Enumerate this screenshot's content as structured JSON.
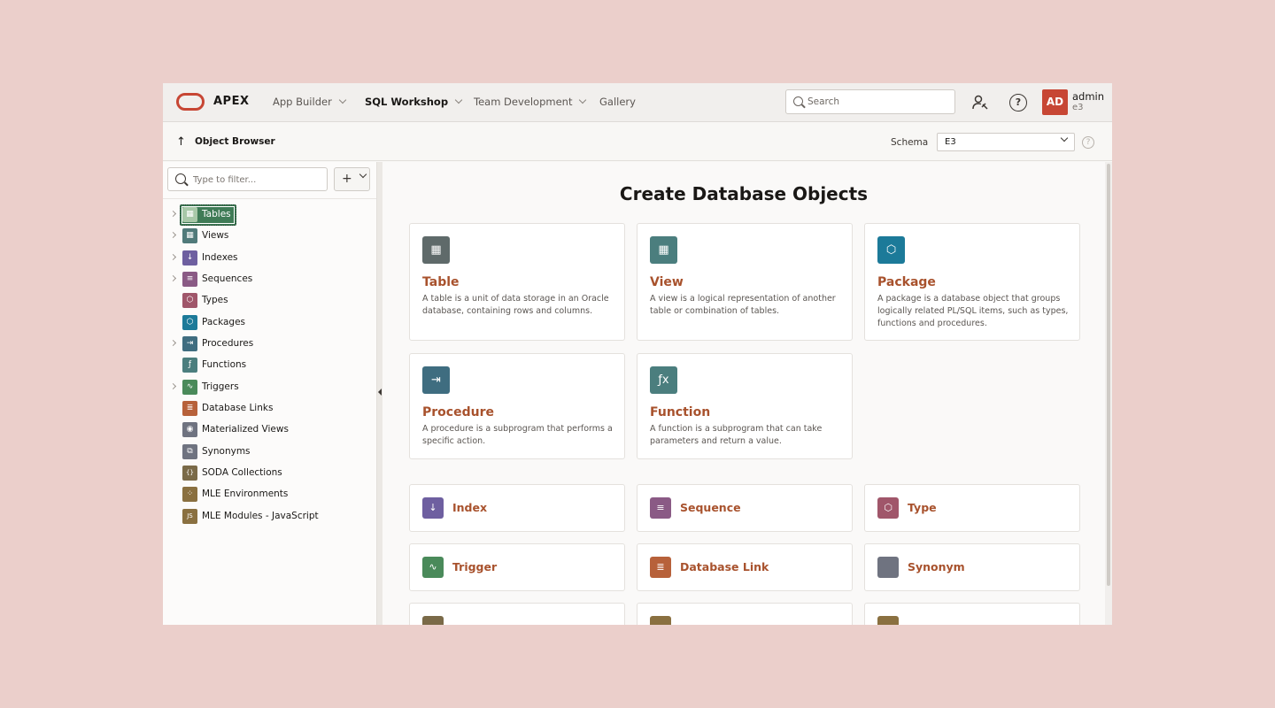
{
  "header": {
    "logo_text": "APEX",
    "nav": [
      {
        "label": "App Builder"
      },
      {
        "label": "SQL Workshop"
      },
      {
        "label": "Team Development"
      },
      {
        "label": "Gallery"
      }
    ],
    "search_placeholder": "Search",
    "help_glyph": "?",
    "user": {
      "initials": "AD",
      "name": "admin",
      "workspace": "e3"
    }
  },
  "titlebar": {
    "up_glyph": "↑",
    "title": "Object Browser",
    "schema_label": "Schema",
    "schema_value": "E3",
    "help_glyph": "?"
  },
  "sidebar": {
    "filter_placeholder": "Type to filter...",
    "add_glyph": "+",
    "items": [
      {
        "label": "Tables",
        "icon": "table-icon",
        "glyph": "▦",
        "expandable": true,
        "selected": true
      },
      {
        "label": "Views",
        "icon": "view-icon",
        "glyph": "▦",
        "expandable": true
      },
      {
        "label": "Indexes",
        "icon": "index-icon",
        "glyph": "↓",
        "expandable": true
      },
      {
        "label": "Sequences",
        "icon": "sequence-icon",
        "glyph": "≡",
        "expandable": true
      },
      {
        "label": "Types",
        "icon": "type-icon",
        "glyph": "⬡",
        "expandable": false
      },
      {
        "label": "Packages",
        "icon": "package-icon",
        "glyph": "⬡",
        "expandable": false
      },
      {
        "label": "Procedures",
        "icon": "procedure-icon",
        "glyph": "⇥",
        "expandable": true
      },
      {
        "label": "Functions",
        "icon": "function-icon",
        "glyph": "ƒ",
        "expandable": false
      },
      {
        "label": "Triggers",
        "icon": "trigger-icon",
        "glyph": "∿",
        "expandable": true
      },
      {
        "label": "Database Links",
        "icon": "database-link-icon",
        "glyph": "≣",
        "expandable": false
      },
      {
        "label": "Materialized Views",
        "icon": "materialized-view-icon",
        "glyph": "◉",
        "expandable": false
      },
      {
        "label": "Synonyms",
        "icon": "synonym-icon",
        "glyph": "⧉",
        "expandable": false
      },
      {
        "label": "SODA Collections",
        "icon": "soda-collection-icon",
        "glyph": "{}",
        "expandable": false
      },
      {
        "label": "MLE Environments",
        "icon": "mle-environment-icon",
        "glyph": "⁘",
        "expandable": false
      },
      {
        "label": "MLE Modules - JavaScript",
        "icon": "mle-module-icon",
        "glyph": "JS",
        "expandable": false
      }
    ]
  },
  "main": {
    "title": "Create Database Objects",
    "big_cards": [
      {
        "title": "Table",
        "icon": "table-icon",
        "glyph": "▦",
        "desc": "A table is a unit of data storage in an Oracle database, containing rows and columns."
      },
      {
        "title": "View",
        "icon": "view-icon",
        "glyph": "▦",
        "desc": "A view is a logical representation of another table or combination of tables."
      },
      {
        "title": "Package",
        "icon": "package-icon",
        "glyph": "⬡",
        "desc": "A package is a database object that groups logically related PL/SQL items, such as types, functions and procedures."
      },
      {
        "title": "Procedure",
        "icon": "procedure-icon",
        "glyph": "⇥",
        "desc": "A procedure is a subprogram that performs a specific action."
      },
      {
        "title": "Function",
        "icon": "function-icon",
        "glyph": "ƒx",
        "desc": "A function is a subprogram that can take parameters and return a value."
      }
    ],
    "small_cards": [
      {
        "title": "Index",
        "icon": "index-icon",
        "glyph": "↓"
      },
      {
        "title": "Sequence",
        "icon": "sequence-icon",
        "glyph": "≡"
      },
      {
        "title": "Type",
        "icon": "type-icon",
        "glyph": "⬡"
      },
      {
        "title": "Trigger",
        "icon": "trigger-icon",
        "glyph": "∿"
      },
      {
        "title": "Database Link",
        "icon": "database-link-icon",
        "glyph": "≣"
      },
      {
        "title": "Synonym",
        "icon": "synonym-icon",
        "glyph": "⧉"
      }
    ]
  }
}
